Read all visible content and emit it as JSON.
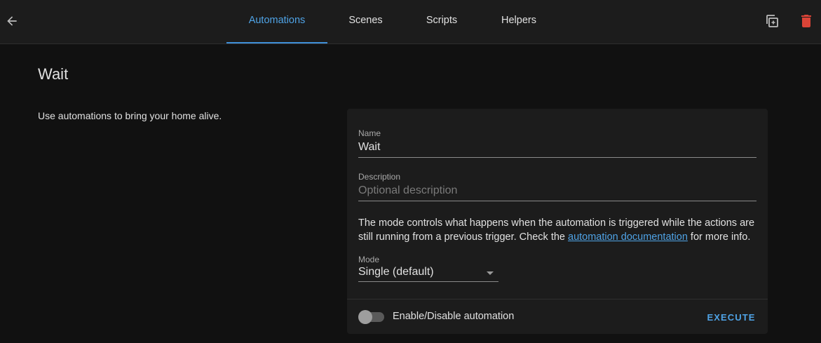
{
  "header": {
    "tabs": [
      {
        "label": "Automations",
        "active": true
      },
      {
        "label": "Scenes",
        "active": false
      },
      {
        "label": "Scripts",
        "active": false
      },
      {
        "label": "Helpers",
        "active": false
      }
    ],
    "icons": {
      "back": "arrow-left-icon",
      "duplicate": "content-duplicate-icon",
      "delete": "delete-icon"
    }
  },
  "page": {
    "title": "Wait",
    "intro": "Use automations to bring your home alive."
  },
  "form": {
    "name_label": "Name",
    "name_value": "Wait",
    "description_label": "Description",
    "description_placeholder": "Optional description",
    "mode_text_before": "The mode controls what happens when the automation is triggered while the actions are still running from a previous trigger. Check the ",
    "mode_link": "automation documentation",
    "mode_text_after": " for more info.",
    "mode_label": "Mode",
    "mode_value": "Single (default)",
    "toggle_label": "Enable/Disable automation",
    "toggle_enabled": false,
    "execute_label": "EXECUTE"
  },
  "colors": {
    "accent": "#4fa3e6",
    "delete": "#db4437",
    "background": "#111111",
    "card": "#1c1c1c"
  }
}
